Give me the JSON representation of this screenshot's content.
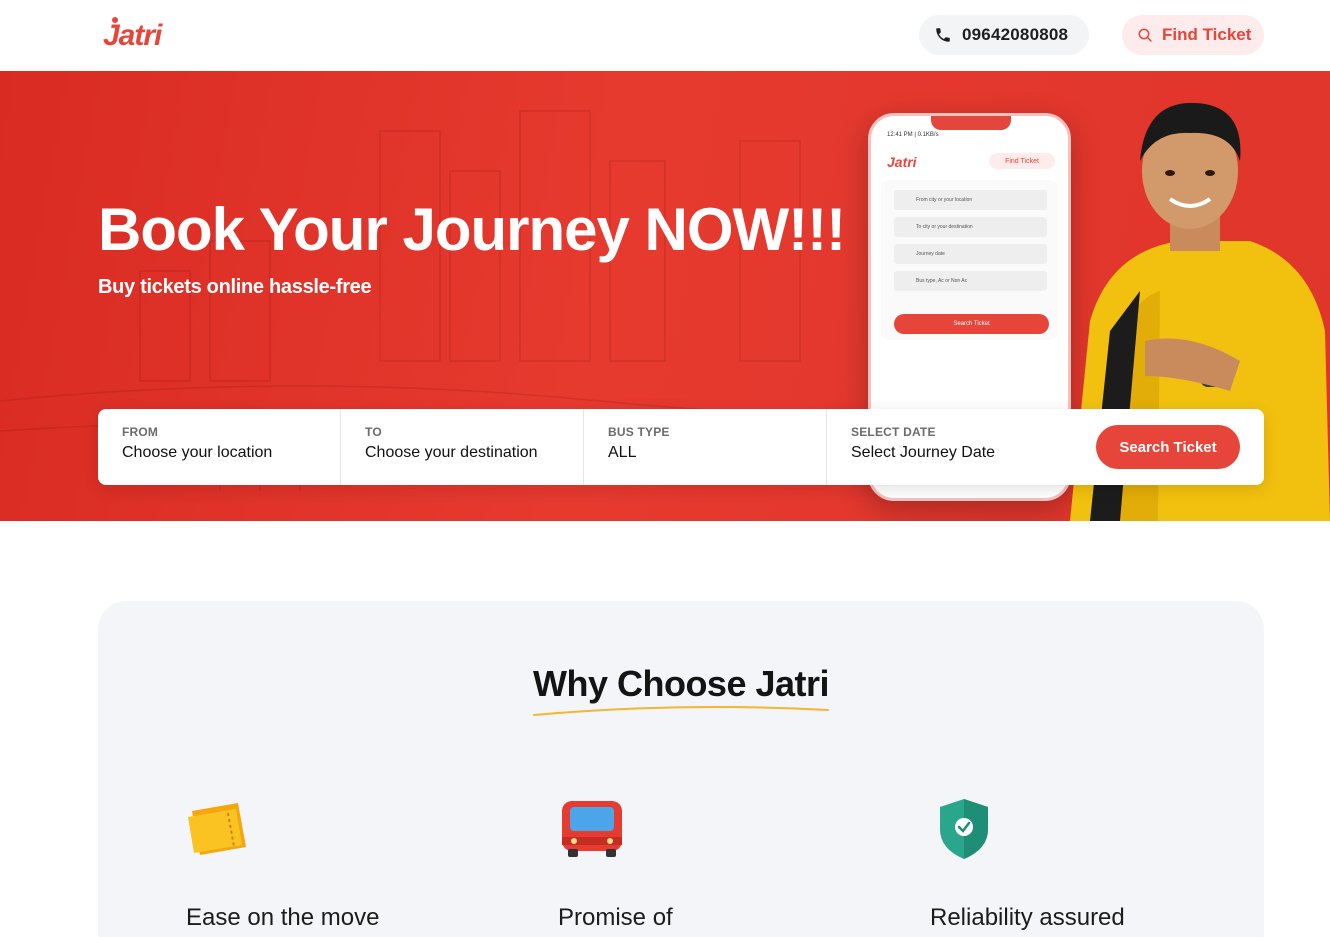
{
  "header": {
    "logo_text": "Jatri",
    "phone_icon": "phone-icon",
    "phone_number": "09642080808",
    "find_icon": "search-icon",
    "find_ticket_label": "Find Ticket"
  },
  "hero": {
    "title": "Book Your Journey NOW!!!",
    "subtitle": "Buy tickets online hassle-free",
    "search": {
      "fields": [
        {
          "label": "FROM",
          "value": "Choose your location"
        },
        {
          "label": "TO",
          "value": "Choose your destination"
        },
        {
          "label": "BUS TYPE",
          "value": "ALL"
        },
        {
          "label": "SELECT DATE",
          "value": "Select Journey Date"
        }
      ],
      "button_label": "Search Ticket"
    },
    "phone_mockup": {
      "status_time": "12:41 PM | 0.1KB/s",
      "logo_text": "Jatri",
      "find_ticket_label": "Find Ticket",
      "rows": [
        "From city or your location",
        "To city or your destination",
        "Journey date",
        "Bus type, Ac or Non Ac"
      ],
      "button_label": "Search Ticket"
    }
  },
  "why": {
    "title": "Why Choose Jatri",
    "features": [
      {
        "icon": "ticket-icon",
        "title": "Ease on the move"
      },
      {
        "icon": "bus-icon",
        "title": "Promise of"
      },
      {
        "icon": "shield-check-icon",
        "title": "Reliability assured"
      }
    ]
  },
  "colors": {
    "brand_red": "#e8453a",
    "hero_red": "#e0352b",
    "section_bg": "#f3f5f8",
    "underline_yellow": "#f2b632"
  }
}
